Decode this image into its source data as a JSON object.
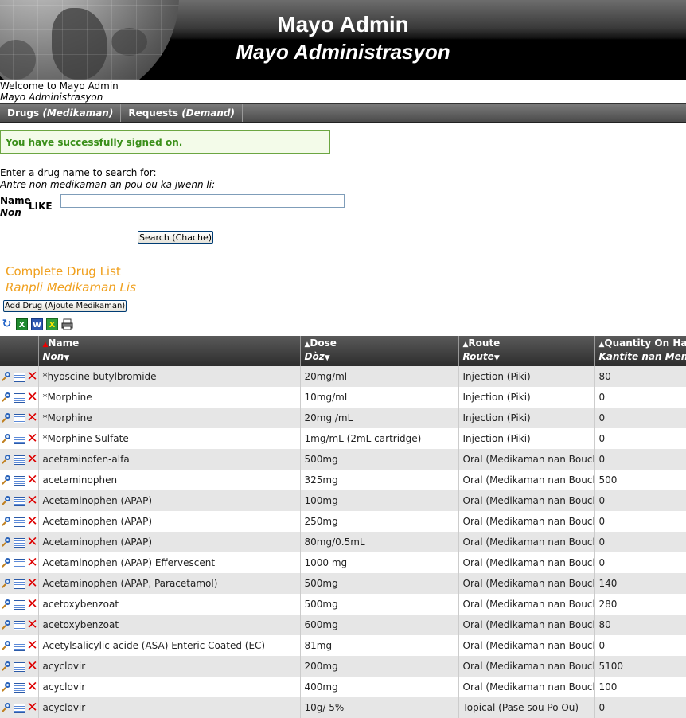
{
  "header": {
    "title": "Mayo Admin",
    "subtitle": "Mayo Administrasyon"
  },
  "welcome": {
    "line1": "Welcome to Mayo Admin",
    "line2": "Mayo Administrasyon"
  },
  "menu": {
    "items": [
      {
        "label": "Drugs ",
        "label_alt": "(Medikaman)"
      },
      {
        "label": "Requests ",
        "label_alt": "(Demand)"
      }
    ]
  },
  "message": "You have successfully signed on.",
  "search": {
    "prompt_line1": "Enter a drug name to search for:",
    "prompt_line2": "Antre non medikaman an pou ou ka jwenn li:",
    "name_label": "Name",
    "name_label_alt": "Non",
    "operator": "LIKE",
    "value": "",
    "button": "Search (Chache)"
  },
  "list": {
    "heading": "Complete Drug List",
    "heading_alt": "Ranpli Medikaman Lis",
    "add_button": "Add Drug (Ajoute Medikaman)",
    "export_icons": [
      "refresh-icon",
      "excel-icon",
      "word-icon",
      "xml-icon",
      "print-icon"
    ]
  },
  "table": {
    "columns": [
      {
        "label": "Name",
        "label_alt": "Non"
      },
      {
        "label": "Dose",
        "label_alt": "Dòz"
      },
      {
        "label": "Route",
        "label_alt": "Route"
      },
      {
        "label": "Quantity On Hand",
        "label_alt": "Kantite nan Men"
      }
    ],
    "rows": [
      {
        "name": "*hyoscine butylbromide",
        "dose": "20mg/ml",
        "route": "Injection (Piki)",
        "qty": "80"
      },
      {
        "name": "*Morphine",
        "dose": "10mg/mL",
        "route": "Injection (Piki)",
        "qty": "0"
      },
      {
        "name": "*Morphine",
        "dose": "20mg /mL",
        "route": "Injection (Piki)",
        "qty": "0"
      },
      {
        "name": "*Morphine Sulfate",
        "dose": "1mg/mL (2mL cartridge)",
        "route": "Injection (Piki)",
        "qty": "0"
      },
      {
        "name": "acetaminofen-alfa",
        "dose": "500mg",
        "route": "Oral (Medikaman nan Bouch)",
        "qty": "0"
      },
      {
        "name": "acetaminophen",
        "dose": "325mg",
        "route": "Oral (Medikaman nan Bouch)",
        "qty": "500"
      },
      {
        "name": "Acetaminophen (APAP)",
        "dose": "100mg",
        "route": "Oral (Medikaman nan Bouch)",
        "qty": "0"
      },
      {
        "name": "Acetaminophen (APAP)",
        "dose": "250mg",
        "route": "Oral (Medikaman nan Bouch)",
        "qty": "0"
      },
      {
        "name": "Acetaminophen (APAP)",
        "dose": "80mg/0.5mL",
        "route": "Oral (Medikaman nan Bouch)",
        "qty": "0"
      },
      {
        "name": "Acetaminophen (APAP) Effervescent",
        "dose": "1000 mg",
        "route": "Oral (Medikaman nan Bouch)",
        "qty": "0"
      },
      {
        "name": "Acetaminophen (APAP, Paracetamol)",
        "dose": "500mg",
        "route": "Oral (Medikaman nan Bouch)",
        "qty": "140"
      },
      {
        "name": "acetoxybenzoat",
        "dose": "500mg",
        "route": "Oral (Medikaman nan Bouch)",
        "qty": "280"
      },
      {
        "name": "acetoxybenzoat",
        "dose": "600mg",
        "route": "Oral (Medikaman nan Bouch)",
        "qty": "80"
      },
      {
        "name": "Acetylsalicylic acide (ASA) Enteric Coated (EC)",
        "dose": "81mg",
        "route": "Oral (Medikaman nan Bouch)",
        "qty": "0"
      },
      {
        "name": "acyclovir",
        "dose": "200mg",
        "route": "Oral (Medikaman nan Bouch)",
        "qty": "5100"
      },
      {
        "name": "acyclovir",
        "dose": "400mg",
        "route": "Oral (Medikaman nan Bouch)",
        "qty": "100"
      },
      {
        "name": "acyclovir",
        "dose": "10g/ 5%",
        "route": "Topical (Pase sou Po Ou)",
        "qty": "0"
      }
    ]
  },
  "colors": {
    "accent_orange": "#f0a01e",
    "success_green": "#3a8f19",
    "delete_red": "#dd0000"
  }
}
